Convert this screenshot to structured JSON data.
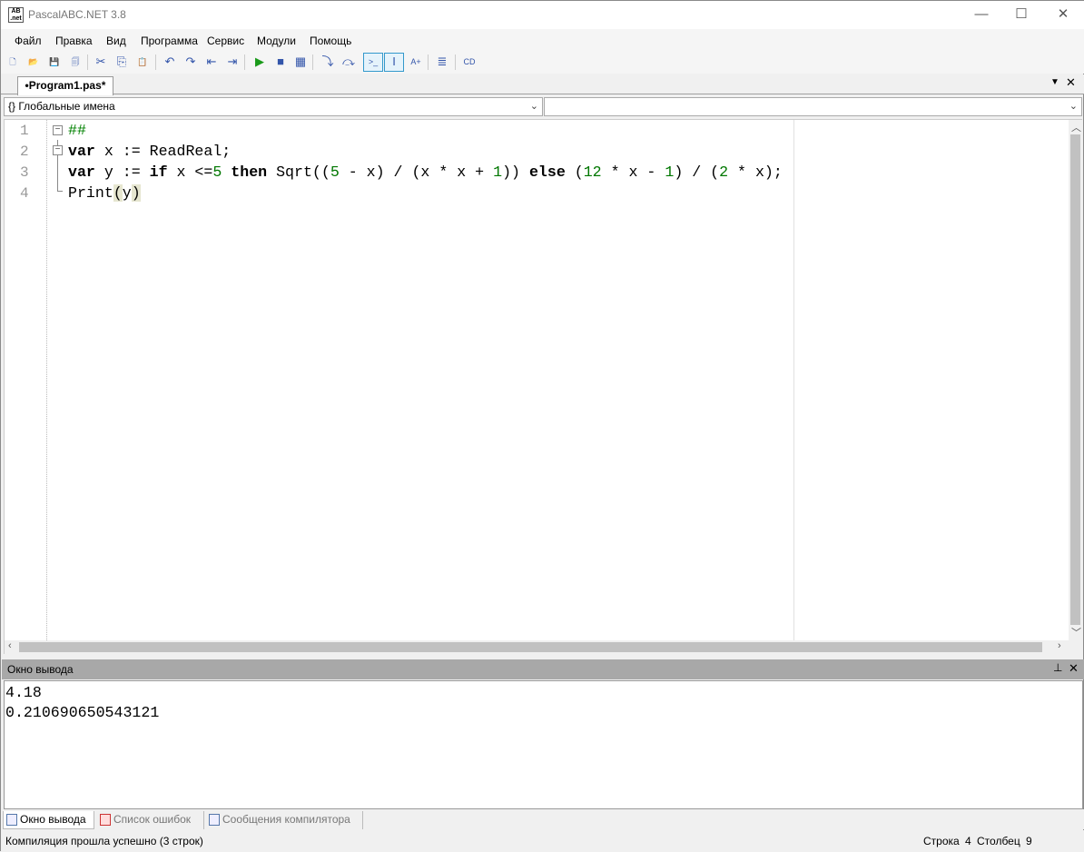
{
  "window": {
    "title": "PascalABC.NET 3.8",
    "app_icon_text": "AB .net",
    "minimize": "—",
    "maximize": "☐",
    "close": "✕"
  },
  "menu": [
    "Файл",
    "Правка",
    "Вид",
    "Программа",
    "Сервис",
    "Модули",
    "Помощь"
  ],
  "toolbar": [
    {
      "name": "new-file-icon",
      "g": "🗋"
    },
    {
      "name": "open-icon",
      "g": "📂"
    },
    {
      "name": "save-icon",
      "g": "💾"
    },
    {
      "name": "save-all-icon",
      "g": "🗐"
    },
    {
      "name": "cut-icon",
      "g": "✂"
    },
    {
      "name": "copy-icon",
      "g": "⎘"
    },
    {
      "name": "paste-icon",
      "g": "📋"
    },
    {
      "name": "undo-icon",
      "g": "↶"
    },
    {
      "name": "redo-icon",
      "g": "↷"
    },
    {
      "name": "outdent-icon",
      "g": "⇤"
    },
    {
      "name": "indent-icon",
      "g": "⇥"
    },
    {
      "name": "run-icon",
      "g": "▶",
      "color": "#1a9a1a"
    },
    {
      "name": "stop-icon",
      "g": "■"
    },
    {
      "name": "compile-icon",
      "g": "▦"
    },
    {
      "name": "step-into-icon",
      "g": "⤵"
    },
    {
      "name": "step-over-icon",
      "g": "⤼"
    },
    {
      "name": "console-icon",
      "g": ">_",
      "on": true
    },
    {
      "name": "text-cursor-icon",
      "g": "I",
      "on": true
    },
    {
      "name": "abc-icon",
      "g": "A+"
    },
    {
      "name": "format-icon",
      "g": "≣"
    },
    {
      "name": "code-icon",
      "g": "CD"
    }
  ],
  "editor": {
    "tab_label": "•Program1.pas*",
    "scope_combo": "{} Глобальные имена",
    "member_combo": "",
    "line_numbers": [
      "1",
      "2",
      "3",
      "4"
    ],
    "lines": [
      [
        {
          "t": "##",
          "k": "cm"
        }
      ],
      [
        {
          "t": "var",
          "k": "kw"
        },
        {
          "t": " x := ReadReal;"
        }
      ],
      [
        {
          "t": "var",
          "k": "kw"
        },
        {
          "t": " y := "
        },
        {
          "t": "if",
          "k": "kw"
        },
        {
          "t": " x <="
        },
        {
          "t": "5",
          "k": "num"
        },
        {
          "t": " "
        },
        {
          "t": "then",
          "k": "kw"
        },
        {
          "t": " Sqrt(("
        },
        {
          "t": "5",
          "k": "num"
        },
        {
          "t": " - x) / (x * x + "
        },
        {
          "t": "1",
          "k": "num"
        },
        {
          "t": ")) "
        },
        {
          "t": "else",
          "k": "kw"
        },
        {
          "t": " ("
        },
        {
          "t": "12",
          "k": "num"
        },
        {
          "t": " * x - "
        },
        {
          "t": "1",
          "k": "num"
        },
        {
          "t": ") / ("
        },
        {
          "t": "2",
          "k": "num"
        },
        {
          "t": " * x);"
        }
      ],
      [
        {
          "t": "Print"
        },
        {
          "t": "(",
          "k": "hl"
        },
        {
          "t": "y"
        },
        {
          "t": ")",
          "k": "hl"
        }
      ]
    ]
  },
  "output": {
    "title": "Окно вывода",
    "pin": "📌",
    "close": "✕",
    "lines": [
      "4.18",
      "0.210690650543121"
    ]
  },
  "bottom_tabs": [
    "Окно вывода",
    "Список ошибок",
    "Сообщения компилятора"
  ],
  "status": {
    "message": "Компиляция прошла успешно (3 строк)",
    "row_label": "Строка",
    "row": "4",
    "col_label": "Столбец",
    "col": "9"
  }
}
